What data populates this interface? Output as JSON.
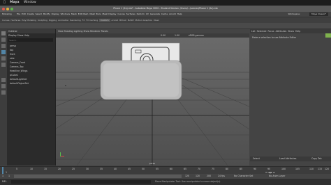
{
  "menubar": {
    "apple": "",
    "app": "Maya",
    "items": [
      "Window"
    ]
  },
  "titlebar": {
    "title": "Phone 1 (2a).mb* - Autodesk Maya 2020 - Student Version: /Users/.../scenes/Phone 1 (2a).mb",
    "workspace_label": "Workspace:",
    "workspace_value": "Maya Classic*"
  },
  "main_menu": [
    "Modeling",
    "File",
    "Edit",
    "Create",
    "Select",
    "Modify",
    "Display",
    "Windows",
    "Mesh",
    "Edit Mesh",
    "Mesh Tools",
    "Mesh Display",
    "Curves",
    "Surfaces",
    "Deform",
    "UV",
    "Generate",
    "Cache",
    "Arnold",
    "Help"
  ],
  "status": {
    "mode": "Modeling",
    "symmetry": "Symmetry: Off",
    "no_live": "No Live Surface",
    "login": "Sign In"
  },
  "shelf_tabs": [
    "Curves / Surfaces",
    "Poly Modeling",
    "Sculpting",
    "Rigging",
    "Animation",
    "Rendering",
    "FX",
    "FX Caching",
    "Custom",
    "Arnold",
    "Bifrost",
    "MASH",
    "Motion Graphics",
    "XGen"
  ],
  "outliner": {
    "title": "Outliner",
    "menu": [
      "Display",
      "Show",
      "Help"
    ],
    "search_placeholder": "Search...",
    "items": [
      "persp",
      "top",
      "front",
      "side",
      "Camera_Front",
      "Camera_Top",
      "Headline_Wings",
      "pCube1",
      "defaultLightSet",
      "defaultObjectSet"
    ]
  },
  "viewport": {
    "menu": [
      "View",
      "Shading",
      "Lighting",
      "Show",
      "Renderer",
      "Panels"
    ],
    "camera_label": "persp",
    "gamma": "sRGB gamma",
    "exposure": "0.00",
    "gamma_val": "1.00",
    "label_b": "B"
  },
  "right_panel": {
    "tabs": [
      "List",
      "Selected",
      "Focus",
      "Attributes",
      "Show",
      "Help"
    ],
    "message": "Make a selection to see Attribute Editor",
    "select_btn": "Select",
    "load_btn": "Load Attributes",
    "copy_btn": "Copy Tab"
  },
  "timeline": {
    "ticks": [
      "1",
      "5",
      "10",
      "15",
      "20",
      "25",
      "30",
      "35",
      "40",
      "45",
      "50",
      "55",
      "60",
      "65",
      "70",
      "75",
      "80",
      "85",
      "90",
      "95",
      "100",
      "105",
      "110",
      "115",
      "120"
    ],
    "current": "1"
  },
  "range": {
    "start": "1",
    "inner_start": "1",
    "inner_end": "120",
    "end": "120",
    "end2": "200",
    "fps": "24 fps",
    "char_set": "No Character Set",
    "anim_layer": "No Anim Layer"
  },
  "command": {
    "lang": "MEL",
    "help": "Move Manipulator Tool: Use manipulator to move object(s)."
  },
  "colors": {
    "accent": "#5285a6",
    "shelf_green": "#7fb24d",
    "shelf_blue": "#4d8fcf",
    "shelf_yellow": "#d6b84a"
  }
}
